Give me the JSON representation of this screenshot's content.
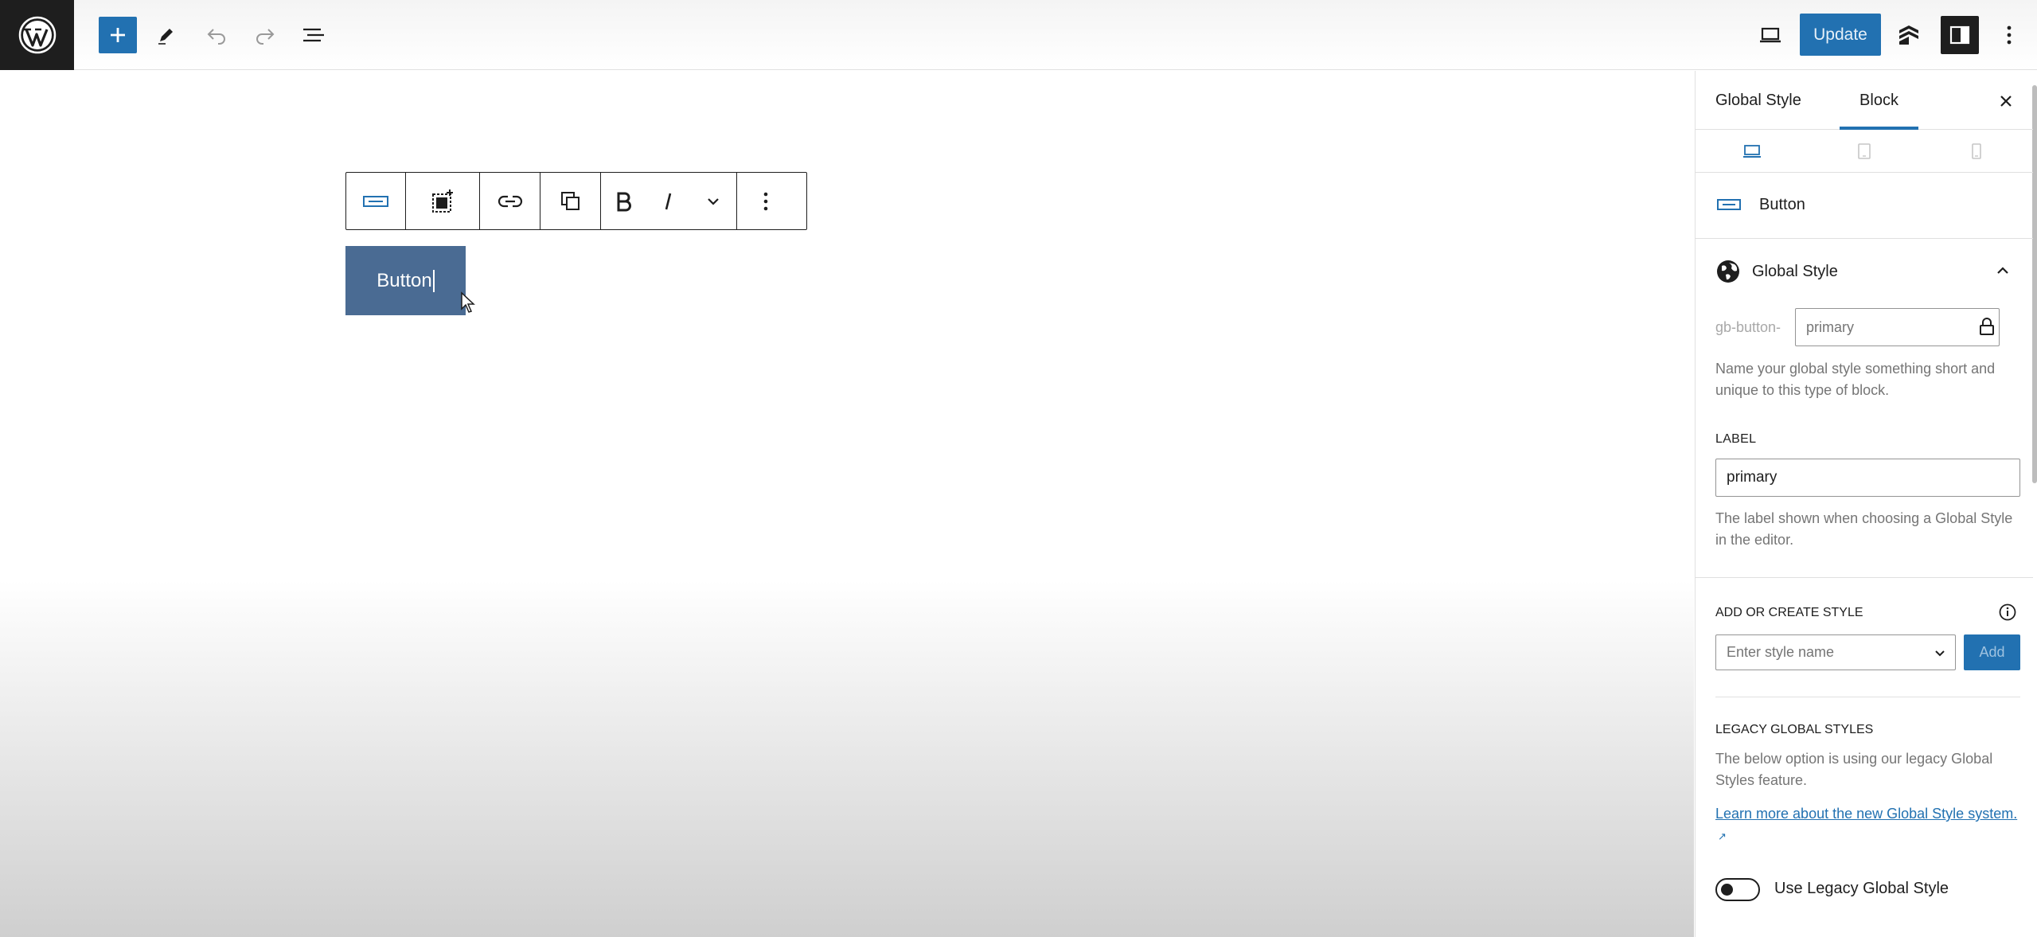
{
  "topbar": {
    "update_label": "Update",
    "icons": [
      "wordpress-logo-icon",
      "plus-icon",
      "pencil-icon",
      "undo-icon",
      "redo-icon",
      "list-view-icon",
      "desktop-preview-icon",
      "generateblocks-icon",
      "sidebar-toggle-icon",
      "vertical-ellipsis-icon"
    ]
  },
  "canvas": {
    "button_text": "Button",
    "toolbar_icons": [
      "button-block-icon",
      "select-parent-icon",
      "link-icon",
      "duplicate-icon",
      "bold-icon",
      "italic-icon",
      "more-formats-chevron-icon",
      "options-ellipsis-icon"
    ]
  },
  "sidebar": {
    "tabs": [
      {
        "label": "Global Style",
        "active": false
      },
      {
        "label": "Block",
        "active": true
      }
    ],
    "block_card": {
      "title": "Button"
    },
    "global_style_panel": {
      "title": "Global Style",
      "prefix": "gb-button-",
      "name_placeholder": "primary",
      "name_help": "Name your global style something short and unique to this type of block.",
      "label_heading": "LABEL",
      "label_value": "primary",
      "label_help": "The label shown when choosing a Global Style in the editor.",
      "add_or_create_heading": "ADD OR CREATE STYLE",
      "select_placeholder": "Enter style name",
      "add_button": "Add",
      "legacy_heading": "LEGACY GLOBAL STYLES",
      "legacy_help": "The below option is using our legacy Global Styles feature.",
      "legacy_link": "Learn more about the new Global Style system.",
      "legacy_toggle_label": "Use Legacy Global Style",
      "legacy_toggle_on": false
    }
  },
  "colors": {
    "accent": "#2271b1",
    "button_block_bg": "#4a6b93",
    "dark": "#1e1e1e"
  }
}
